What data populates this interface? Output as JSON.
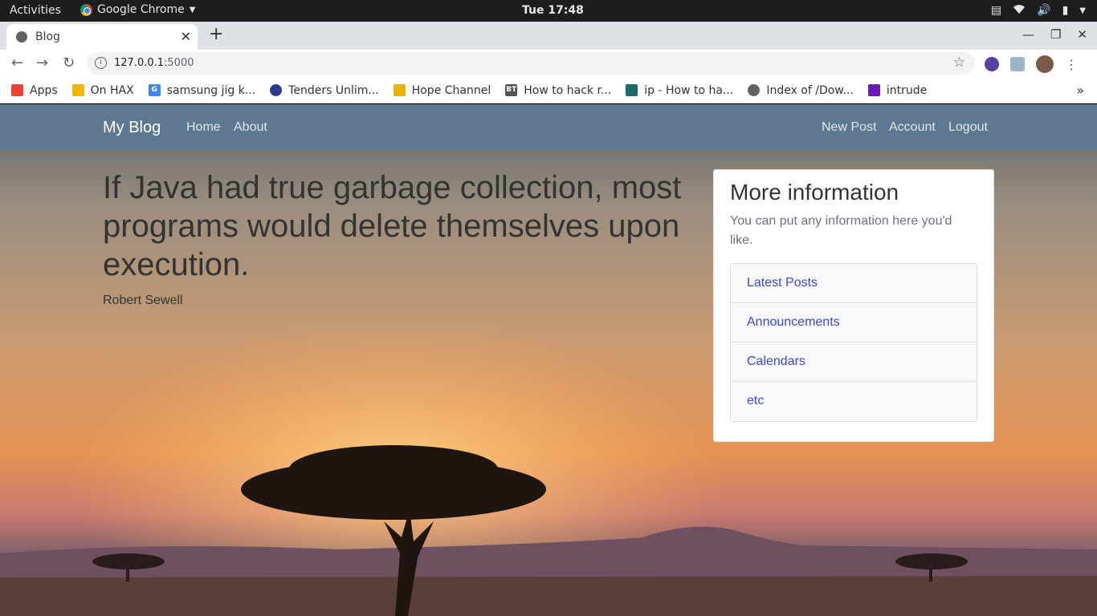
{
  "os_bar": {
    "activities": "Activities",
    "app_name": "Google Chrome",
    "clock": "Tue 17:48"
  },
  "browser": {
    "tab_title": "Blog",
    "url_host": "127.0.0.1",
    "url_port": ":5000",
    "bookmarks": [
      {
        "label": "Apps",
        "icon": "apps-grid-icon",
        "color": "#ea4335"
      },
      {
        "label": "On HAX",
        "icon": "drive-icon",
        "color": "#f4b400"
      },
      {
        "label": "samsung jig k...",
        "icon": "google-icon",
        "color": "#4285f4"
      },
      {
        "label": "Tenders Unlim...",
        "icon": "globe-icon",
        "color": "#2a3a8f"
      },
      {
        "label": "Hope Channel",
        "icon": "hope-channel-icon",
        "color": "#e8b400"
      },
      {
        "label": "How to hack r...",
        "icon": "bt-icon",
        "color": "#555555"
      },
      {
        "label": "ip - How to ha...",
        "icon": "shield-icon",
        "color": "#1b6b6b"
      },
      {
        "label": "Index of /Dow...",
        "icon": "globe-icon",
        "color": "#5f6368"
      },
      {
        "label": "intrude",
        "icon": "save-icon",
        "color": "#6a1bb5"
      }
    ]
  },
  "site": {
    "brand": "My Blog",
    "nav_left": [
      "Home",
      "About"
    ],
    "nav_right": [
      "New Post",
      "Account",
      "Logout"
    ],
    "quote_text": "If Java had true garbage collection, most programs would delete themselves upon execution.",
    "quote_author": "Robert Sewell",
    "sidebar": {
      "title": "More information",
      "description": "You can put any information here you'd like.",
      "links": [
        "Latest Posts",
        "Announcements",
        "Calendars",
        "etc"
      ]
    },
    "colors": {
      "navbar": "#5f7891",
      "link": "#3b48d8"
    }
  }
}
